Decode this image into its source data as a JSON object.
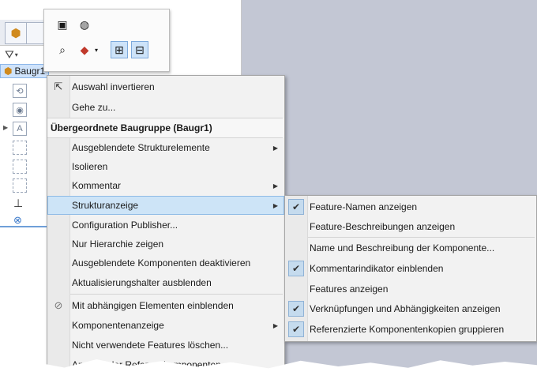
{
  "tree": {
    "assembly_label": "Baugr1"
  },
  "main_menu": {
    "items": [
      {
        "label": "Auswahl invertieren",
        "icon": "select-invert-icon"
      },
      {
        "label": "Gehe zu..."
      },
      {
        "label": "Übergeordnete Baugruppe (Baugr1)",
        "header": true
      },
      {
        "label": "Ausgeblendete Strukturelemente",
        "submenu": true
      },
      {
        "label": "Isolieren"
      },
      {
        "label": "Kommentar",
        "submenu": true
      },
      {
        "label": "Strukturanzeige",
        "submenu": true,
        "highlighted": true
      },
      {
        "label": "Configuration Publisher..."
      },
      {
        "label": "Nur Hierarchie zeigen"
      },
      {
        "label": "Ausgeblendete Komponenten deaktivieren"
      },
      {
        "label": "Aktualisierungshalter ausblenden"
      },
      {
        "label": "Mit abhängigen Elementen einblenden",
        "icon": "show-dependent-icon"
      },
      {
        "label": "Komponentenanzeige",
        "submenu": true
      },
      {
        "label": "Nicht verwendete Features löschen..."
      },
      {
        "label": "Anzeige der Referenzkomponenten"
      }
    ]
  },
  "sub_menu": {
    "items": [
      {
        "label": "Feature-Namen anzeigen",
        "checked": true
      },
      {
        "label": "Feature-Beschreibungen anzeigen",
        "checked": false
      },
      {
        "label": "Name und Beschreibung der Komponente...",
        "checked": false
      },
      {
        "label": "Kommentarindikator einblenden",
        "checked": true
      },
      {
        "label": "Features anzeigen",
        "checked": false
      },
      {
        "label": "Verknüpfungen und Abhängigkeiten anzeigen",
        "checked": true
      },
      {
        "label": "Referenzierte Komponentenkopien gruppieren",
        "checked": true
      }
    ],
    "check_glyph": "✔"
  },
  "colors": {
    "highlight": "#cde4f7",
    "viewport": "#c3c7d4",
    "menu_bg": "#f2f2f2"
  }
}
